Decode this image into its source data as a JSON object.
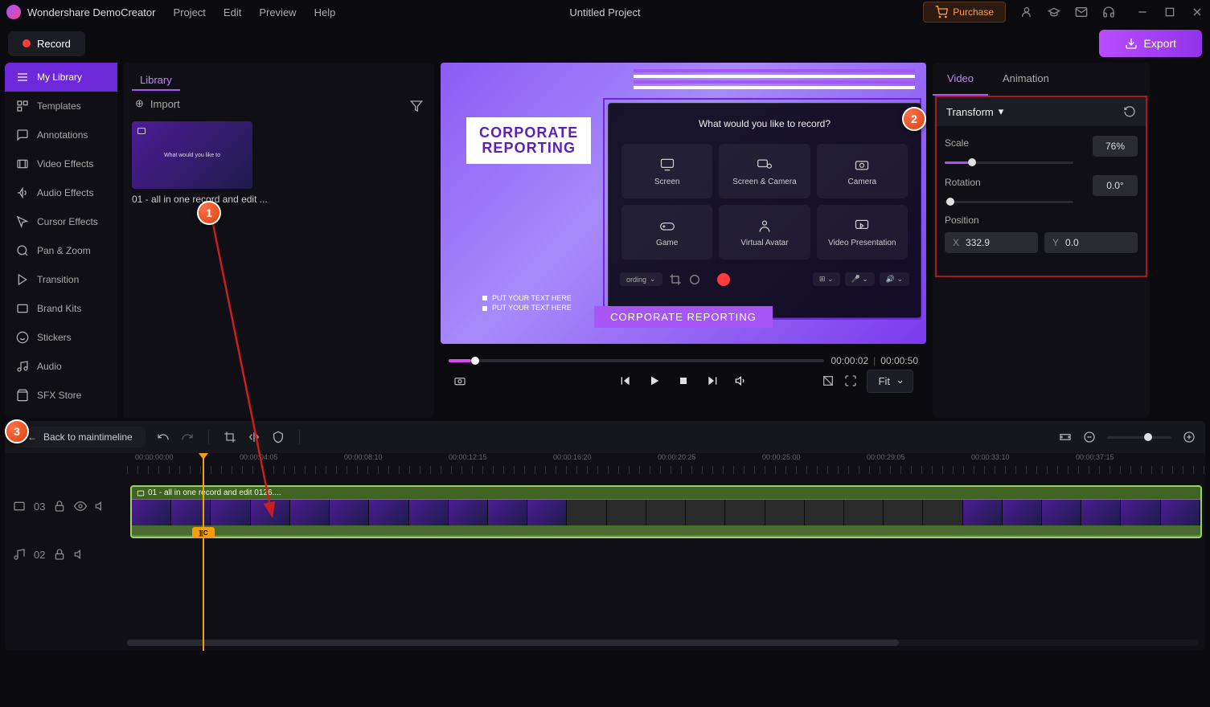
{
  "app": {
    "name": "Wondershare DemoCreator",
    "project_title": "Untitled Project"
  },
  "menu": {
    "items": [
      "Project",
      "Edit",
      "Preview",
      "Help"
    ]
  },
  "purchase": "Purchase",
  "toolbar": {
    "record": "Record",
    "export": "Export"
  },
  "sidebar": {
    "items": [
      "My Library",
      "Templates",
      "Annotations",
      "Video Effects",
      "Audio Effects",
      "Cursor Effects",
      "Pan & Zoom",
      "Transition",
      "Brand Kits",
      "Stickers",
      "Audio",
      "SFX Store"
    ],
    "active": 0
  },
  "library": {
    "tab": "Library",
    "import": "Import",
    "clip_thumb_text": "What would you like to",
    "clip_name": "01 - all in one record and edit ..."
  },
  "preview": {
    "corp_line1": "CORPORATE",
    "corp_line2": "REPORTING",
    "overlay_title": "What would you like to record?",
    "cards": [
      "Screen",
      "Screen & Camera",
      "Camera",
      "Game",
      "Virtual Avatar",
      "Video Presentation"
    ],
    "ov_recording": "ording",
    "corp_label": "CORPORATE REPORTING",
    "put_text_1": "PUT YOUR TEXT HERE",
    "put_text_2": "PUT YOUR TEXT HERE",
    "time_current": "00:00:02",
    "time_total": "00:00:50",
    "fit": "Fit"
  },
  "props": {
    "tabs": [
      "Video",
      "Animation"
    ],
    "active": 0,
    "transform": "Transform",
    "scale_label": "Scale",
    "scale_value": "76%",
    "rotation_label": "Rotation",
    "rotation_value": "0.0°",
    "position_label": "Position",
    "pos_x_label": "X",
    "pos_x_value": "332.9",
    "pos_y_label": "Y",
    "pos_y_value": "0.0"
  },
  "timeline": {
    "back": "Back to maintimeline",
    "ruler": [
      "00:00:00:00",
      "00:00:04:05",
      "00:00:08:10",
      "00:00:12:15",
      "00:00:16:20",
      "00:00:20:25",
      "00:00:25:00",
      "00:00:29:05",
      "00:00:33:10",
      "00:00:37:15"
    ],
    "track_video_num": "03",
    "track_audio_num": "02",
    "clip_name": "01 - all in one record and edit 0126...."
  },
  "annotations": {
    "1": "1",
    "2": "2",
    "3": "3"
  }
}
